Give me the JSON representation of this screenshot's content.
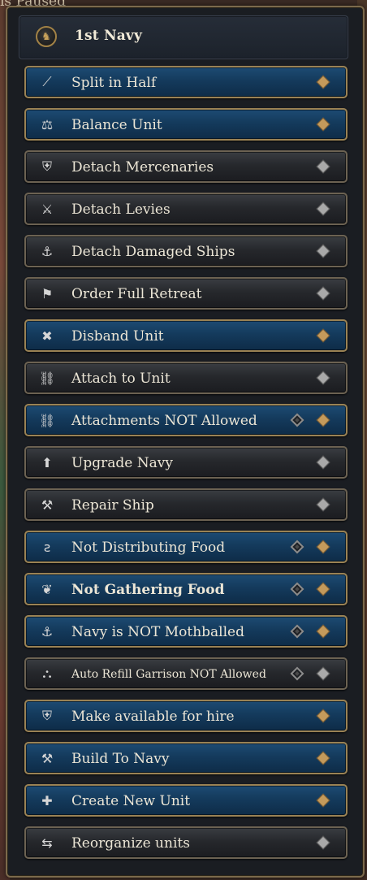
{
  "background": {
    "top_text": "is Paused"
  },
  "header": {
    "title": "1st Navy",
    "emblem_icon": "navy-emblem-icon"
  },
  "colors": {
    "blue_button": "#143a5c",
    "dark_button": "#26282c",
    "gold_marker": "#c49a5b",
    "grey_marker": "#a9a9a9"
  },
  "buttons": [
    {
      "label": "Split in Half",
      "style": "blue",
      "icon": "split-icon",
      "glyph": "⟋",
      "marker": "gold",
      "extra": false
    },
    {
      "label": "Balance Unit",
      "style": "blue",
      "icon": "balance-icon",
      "glyph": "⚖",
      "marker": "gold",
      "extra": false
    },
    {
      "label": "Detach Mercenaries",
      "style": "dark",
      "icon": "mercenary-shield-icon",
      "glyph": "⛨",
      "marker": "grey",
      "extra": false
    },
    {
      "label": "Detach Levies",
      "style": "dark",
      "icon": "levies-icon",
      "glyph": "⚔",
      "marker": "grey",
      "extra": false
    },
    {
      "label": "Detach Damaged Ships",
      "style": "dark",
      "icon": "damaged-ship-icon",
      "glyph": "⚓",
      "marker": "grey",
      "extra": false
    },
    {
      "label": "Order Full Retreat",
      "style": "dark",
      "icon": "retreat-flag-icon",
      "glyph": "⚑",
      "marker": "grey",
      "extra": false
    },
    {
      "label": "Disband Unit",
      "style": "blue",
      "icon": "disband-icon",
      "glyph": "✖",
      "marker": "gold",
      "extra": false
    },
    {
      "label": "Attach to Unit",
      "style": "dark",
      "icon": "chain-link-icon",
      "glyph": "⛓",
      "marker": "grey",
      "extra": false
    },
    {
      "label": "Attachments NOT Allowed",
      "style": "blue",
      "icon": "broken-chain-icon",
      "glyph": "⛓",
      "marker": "gold",
      "extra": true
    },
    {
      "label": "Upgrade Navy",
      "style": "dark",
      "icon": "upgrade-arrow-icon",
      "glyph": "⬆",
      "marker": "grey",
      "extra": false
    },
    {
      "label": "Repair Ship",
      "style": "dark",
      "icon": "repair-icon",
      "glyph": "⚒",
      "marker": "grey",
      "extra": false
    },
    {
      "label": "Not Distributing Food",
      "style": "blue",
      "icon": "food-distribution-icon",
      "glyph": "ƨ",
      "marker": "gold",
      "extra": true
    },
    {
      "label": "Not Gathering Food",
      "style": "blue",
      "icon": "food-gathering-icon",
      "glyph": "❦",
      "marker": "gold",
      "extra": true,
      "bold": true
    },
    {
      "label": "Navy is NOT Mothballed",
      "style": "blue",
      "icon": "anchor-icon",
      "glyph": "⚓",
      "marker": "gold",
      "extra": true
    },
    {
      "label": "Auto Refill Garrison NOT Allowed",
      "style": "dark",
      "icon": "garrison-refill-icon",
      "glyph": "⛬",
      "marker": "grey",
      "extra": true,
      "small": true
    },
    {
      "label": "Make available for hire",
      "style": "blue",
      "icon": "hire-shield-icon",
      "glyph": "⛨",
      "marker": "gold",
      "extra": false
    },
    {
      "label": "Build To Navy",
      "style": "blue",
      "icon": "hammer-icon",
      "glyph": "⚒",
      "marker": "gold",
      "extra": false
    },
    {
      "label": "Create New Unit",
      "style": "blue",
      "icon": "create-unit-icon",
      "glyph": "✚",
      "marker": "gold",
      "extra": false
    },
    {
      "label": "Reorganize units",
      "style": "dark",
      "icon": "reorganize-icon",
      "glyph": "⇆",
      "marker": "grey",
      "extra": false
    }
  ]
}
